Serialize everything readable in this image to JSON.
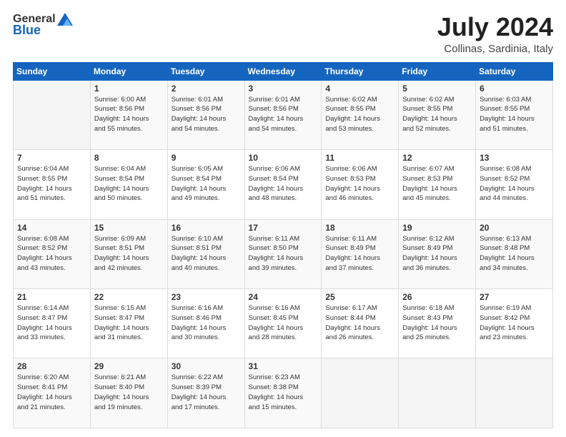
{
  "header": {
    "logo_general": "General",
    "logo_blue": "Blue",
    "month_title": "July 2024",
    "location": "Collinas, Sardinia, Italy"
  },
  "days_of_week": [
    "Sunday",
    "Monday",
    "Tuesday",
    "Wednesday",
    "Thursday",
    "Friday",
    "Saturday"
  ],
  "weeks": [
    [
      {
        "day": "",
        "info": ""
      },
      {
        "day": "1",
        "info": "Sunrise: 6:00 AM\nSunset: 8:56 PM\nDaylight: 14 hours\nand 55 minutes."
      },
      {
        "day": "2",
        "info": "Sunrise: 6:01 AM\nSunset: 8:56 PM\nDaylight: 14 hours\nand 54 minutes."
      },
      {
        "day": "3",
        "info": "Sunrise: 6:01 AM\nSunset: 8:56 PM\nDaylight: 14 hours\nand 54 minutes."
      },
      {
        "day": "4",
        "info": "Sunrise: 6:02 AM\nSunset: 8:55 PM\nDaylight: 14 hours\nand 53 minutes."
      },
      {
        "day": "5",
        "info": "Sunrise: 6:02 AM\nSunset: 8:55 PM\nDaylight: 14 hours\nand 52 minutes."
      },
      {
        "day": "6",
        "info": "Sunrise: 6:03 AM\nSunset: 8:55 PM\nDaylight: 14 hours\nand 51 minutes."
      }
    ],
    [
      {
        "day": "7",
        "info": "Sunrise: 6:04 AM\nSunset: 8:55 PM\nDaylight: 14 hours\nand 51 minutes."
      },
      {
        "day": "8",
        "info": "Sunrise: 6:04 AM\nSunset: 8:54 PM\nDaylight: 14 hours\nand 50 minutes."
      },
      {
        "day": "9",
        "info": "Sunrise: 6:05 AM\nSunset: 8:54 PM\nDaylight: 14 hours\nand 49 minutes."
      },
      {
        "day": "10",
        "info": "Sunrise: 6:06 AM\nSunset: 8:54 PM\nDaylight: 14 hours\nand 48 minutes."
      },
      {
        "day": "11",
        "info": "Sunrise: 6:06 AM\nSunset: 8:53 PM\nDaylight: 14 hours\nand 46 minutes."
      },
      {
        "day": "12",
        "info": "Sunrise: 6:07 AM\nSunset: 8:53 PM\nDaylight: 14 hours\nand 45 minutes."
      },
      {
        "day": "13",
        "info": "Sunrise: 6:08 AM\nSunset: 8:52 PM\nDaylight: 14 hours\nand 44 minutes."
      }
    ],
    [
      {
        "day": "14",
        "info": "Sunrise: 6:08 AM\nSunset: 8:52 PM\nDaylight: 14 hours\nand 43 minutes."
      },
      {
        "day": "15",
        "info": "Sunrise: 6:09 AM\nSunset: 8:51 PM\nDaylight: 14 hours\nand 42 minutes."
      },
      {
        "day": "16",
        "info": "Sunrise: 6:10 AM\nSunset: 8:51 PM\nDaylight: 14 hours\nand 40 minutes."
      },
      {
        "day": "17",
        "info": "Sunrise: 6:11 AM\nSunset: 8:50 PM\nDaylight: 14 hours\nand 39 minutes."
      },
      {
        "day": "18",
        "info": "Sunrise: 6:11 AM\nSunset: 8:49 PM\nDaylight: 14 hours\nand 37 minutes."
      },
      {
        "day": "19",
        "info": "Sunrise: 6:12 AM\nSunset: 8:49 PM\nDaylight: 14 hours\nand 36 minutes."
      },
      {
        "day": "20",
        "info": "Sunrise: 6:13 AM\nSunset: 8:48 PM\nDaylight: 14 hours\nand 34 minutes."
      }
    ],
    [
      {
        "day": "21",
        "info": "Sunrise: 6:14 AM\nSunset: 8:47 PM\nDaylight: 14 hours\nand 33 minutes."
      },
      {
        "day": "22",
        "info": "Sunrise: 6:15 AM\nSunset: 8:47 PM\nDaylight: 14 hours\nand 31 minutes."
      },
      {
        "day": "23",
        "info": "Sunrise: 6:16 AM\nSunset: 8:46 PM\nDaylight: 14 hours\nand 30 minutes."
      },
      {
        "day": "24",
        "info": "Sunrise: 6:16 AM\nSunset: 8:45 PM\nDaylight: 14 hours\nand 28 minutes."
      },
      {
        "day": "25",
        "info": "Sunrise: 6:17 AM\nSunset: 8:44 PM\nDaylight: 14 hours\nand 26 minutes."
      },
      {
        "day": "26",
        "info": "Sunrise: 6:18 AM\nSunset: 8:43 PM\nDaylight: 14 hours\nand 25 minutes."
      },
      {
        "day": "27",
        "info": "Sunrise: 6:19 AM\nSunset: 8:42 PM\nDaylight: 14 hours\nand 23 minutes."
      }
    ],
    [
      {
        "day": "28",
        "info": "Sunrise: 6:20 AM\nSunset: 8:41 PM\nDaylight: 14 hours\nand 21 minutes."
      },
      {
        "day": "29",
        "info": "Sunrise: 6:21 AM\nSunset: 8:40 PM\nDaylight: 14 hours\nand 19 minutes."
      },
      {
        "day": "30",
        "info": "Sunrise: 6:22 AM\nSunset: 8:39 PM\nDaylight: 14 hours\nand 17 minutes."
      },
      {
        "day": "31",
        "info": "Sunrise: 6:23 AM\nSunset: 8:38 PM\nDaylight: 14 hours\nand 15 minutes."
      },
      {
        "day": "",
        "info": ""
      },
      {
        "day": "",
        "info": ""
      },
      {
        "day": "",
        "info": ""
      }
    ]
  ]
}
